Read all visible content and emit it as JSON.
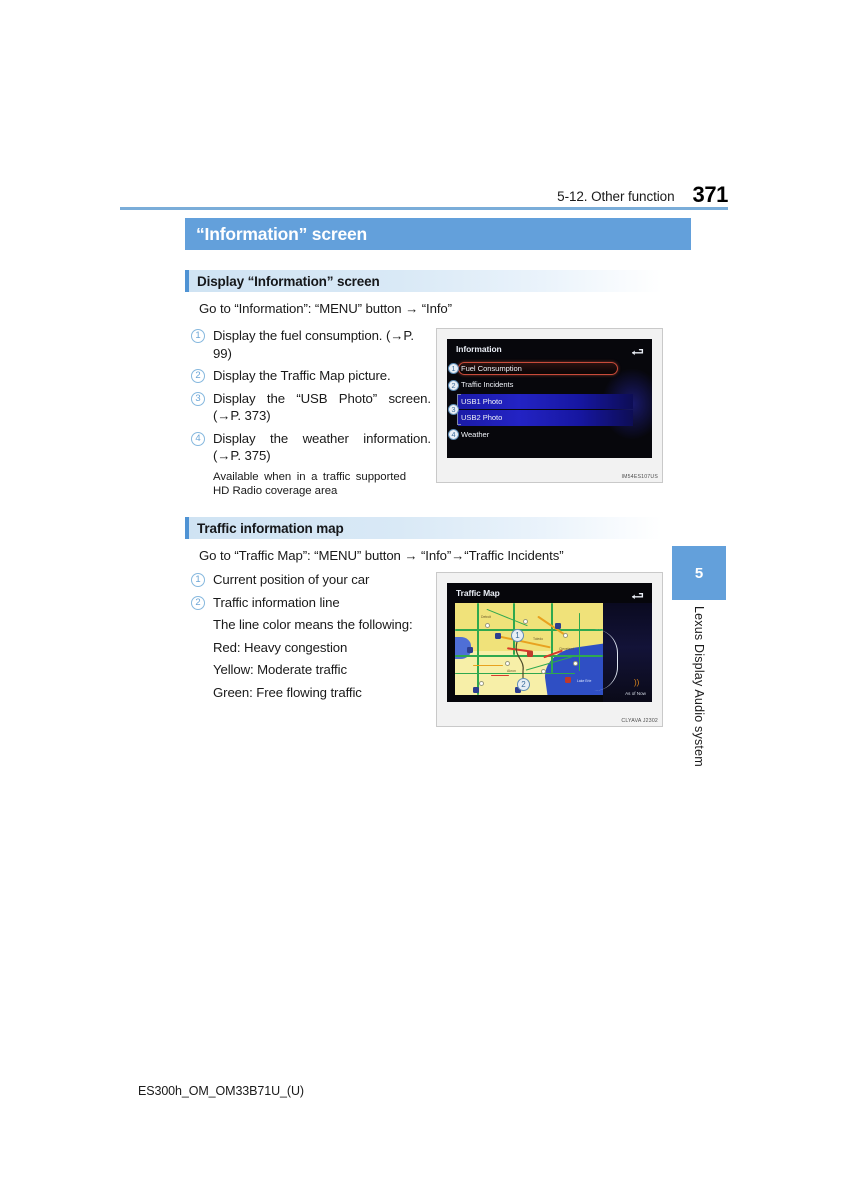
{
  "page": {
    "running_header": "5-12. Other function",
    "page_number": "371",
    "footer": "ES300h_OM_OM33B71U_(U)"
  },
  "banner": {
    "title": "“Information” screen"
  },
  "chapter_tab": {
    "number": "5",
    "vertical_label": "Lexus Display Audio system"
  },
  "sections": [
    {
      "heading": "Display “Information” screen",
      "goto": "Go to “Information”: “MENU” button → “Info”",
      "items": [
        {
          "marker": "1",
          "lines": [
            "Display the fuel consumption.",
            "(→P. 99)"
          ]
        },
        {
          "marker": "2",
          "lines": [
            "Display the Traffic Map picture."
          ]
        },
        {
          "marker": "3",
          "lines": [
            "Display the “USB Photo” screen.",
            "(→P. 373)"
          ]
        },
        {
          "marker": "4",
          "lines": [
            "Display the weather information.",
            "(→P. 375)"
          ]
        }
      ],
      "note": "Available when in a traffic supported HD Radio coverage area",
      "figure": {
        "caption_code": "IM54ES107US",
        "screen_title": "Information",
        "back_icon": "back-arrow-icon",
        "menu_items": [
          {
            "callout": "1",
            "label": "Fuel Consumption",
            "highlight": "red"
          },
          {
            "callout": "2",
            "label": "Traffic Incidents",
            "highlight": "none"
          },
          {
            "callout": "3",
            "label": "USB1 Photo",
            "highlight": "blue"
          },
          {
            "callout": "",
            "label": "USB2 Photo",
            "highlight": "blue"
          },
          {
            "callout": "4",
            "label": "Weather",
            "highlight": "none"
          }
        ]
      }
    },
    {
      "heading": "Traffic information map",
      "goto": "Go to “Traffic Map”: “MENU” button → “Info”→“Traffic Incidents”",
      "items": [
        {
          "marker": "1",
          "lines": [
            "Current position of your car"
          ]
        },
        {
          "marker": "2",
          "lines": [
            "Traffic information line"
          ]
        }
      ],
      "plain_lines": [
        "The line color means the following:",
        "Red: Heavy congestion",
        "Yellow: Moderate traffic",
        "Green: Free flowing traffic"
      ],
      "figure": {
        "caption_code": "CLYAVA J2302",
        "screen_title": "Traffic Map",
        "back_icon": "back-arrow-icon",
        "status_text": "As of Now",
        "hd_icon": "hd-radio-icon",
        "callouts": [
          {
            "label": "1",
            "meaning": "Current position of your car"
          },
          {
            "label": "2",
            "meaning": "Traffic information line"
          }
        ],
        "map_labels": [
          "Detroit",
          "Toledo",
          "Cleveland",
          "Akron",
          "Canton",
          "Lake Erie"
        ]
      }
    }
  ],
  "colors": {
    "banner_blue": "#63a0db",
    "rule_blue": "#7aadd9",
    "subhead_bar": "#4f93d4",
    "marker_outline": "#86b8de",
    "traffic_red": "#d8392c",
    "traffic_yellow": "#e8a21f",
    "traffic_green": "#2fa84f"
  }
}
